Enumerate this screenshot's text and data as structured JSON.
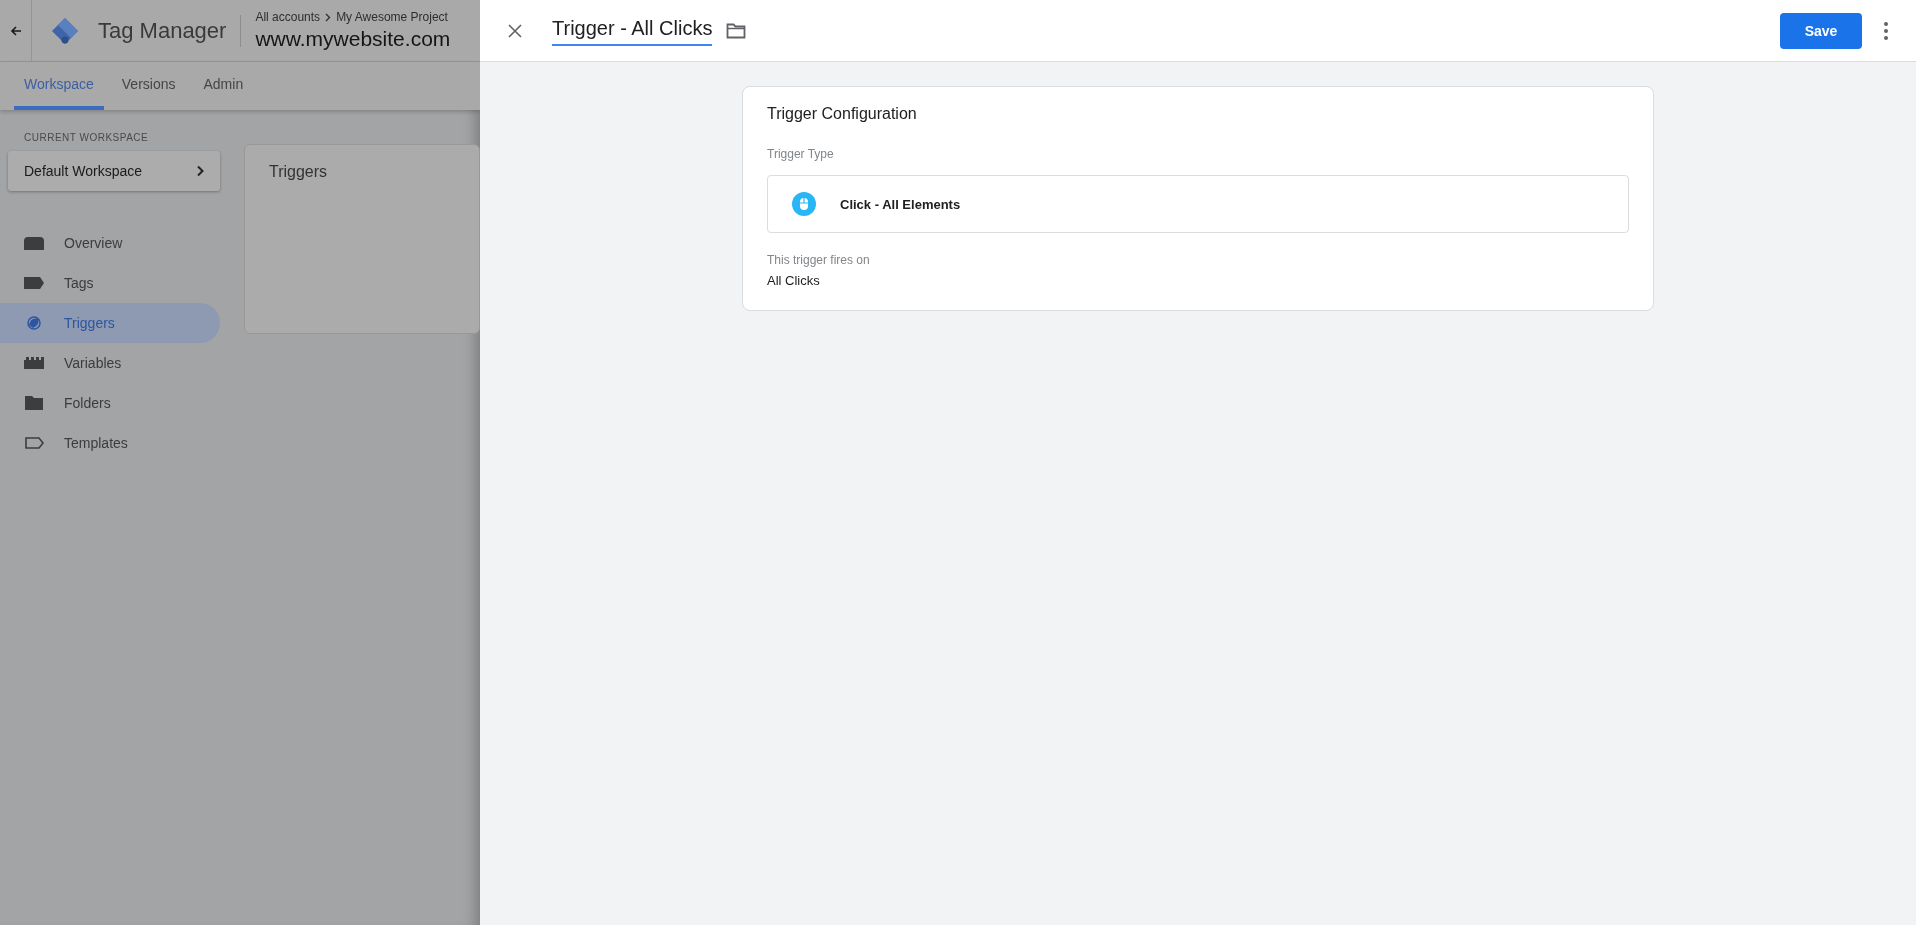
{
  "app_header": {
    "product": "Tag Manager",
    "breadcrumb": [
      "All accounts",
      "My Awesome Project"
    ],
    "container": "www.mywebsite.com"
  },
  "tabs": [
    {
      "label": "Workspace",
      "selected": true
    },
    {
      "label": "Versions",
      "selected": false
    },
    {
      "label": "Admin",
      "selected": false
    }
  ],
  "workspace": {
    "label": "CURRENT WORKSPACE",
    "name": "Default Workspace"
  },
  "nav": [
    {
      "label": "Overview",
      "kind": "overview",
      "selected": false
    },
    {
      "label": "Tags",
      "kind": "tag",
      "selected": false
    },
    {
      "label": "Triggers",
      "kind": "trigger",
      "selected": true
    },
    {
      "label": "Variables",
      "kind": "variable",
      "selected": false
    },
    {
      "label": "Folders",
      "kind": "folder",
      "selected": false
    },
    {
      "label": "Templates",
      "kind": "template",
      "selected": false
    }
  ],
  "content_card": {
    "title": "Triggers"
  },
  "panel": {
    "name": "Trigger - All Clicks",
    "save": "Save",
    "config": {
      "title": "Trigger Configuration",
      "type_label": "Trigger Type",
      "type_name": "Click - All Elements",
      "fires_label": "This trigger fires on",
      "fires_value": "All Clicks"
    }
  }
}
